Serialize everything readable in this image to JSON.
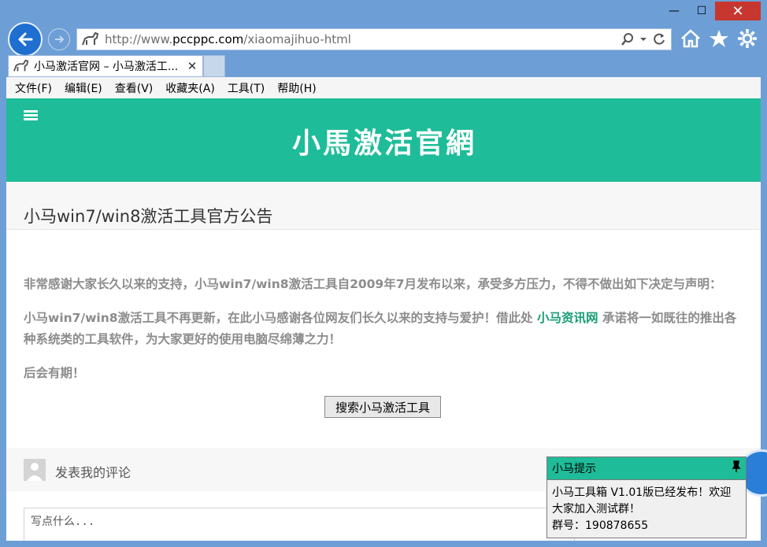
{
  "browser": {
    "url_prefix": "http://www.",
    "url_host": "pccppc.com",
    "url_path": "/xiaomajihuo-html",
    "tab_title": "小马激活官网 – 小马激活工...",
    "window_controls": {
      "minimize": "—",
      "maximize": "☐",
      "close": "✕"
    }
  },
  "menu": {
    "items": [
      "文件(F)",
      "编辑(E)",
      "查看(V)",
      "收藏夹(A)",
      "工具(T)",
      "帮助(H)"
    ]
  },
  "site": {
    "logo_text": "小馬激活官網",
    "notice_title": "小马win7/win8激活工具官方公告",
    "para1": "非常感谢大家长久以来的支持，小马win7/win8激活工具自2009年7月发布以来，承受多方压力，不得不做出如下决定与声明：",
    "para2_before": "小马win7/win8激活工具不再更新，在此小马感谢各位网友们长久以来的支持与爱护！借此处 ",
    "para2_link": "小马资讯网",
    "para2_after": " 承诺将一如既往的推出各种系统类的工具软件，为大家更好的使用电脑尽绵薄之力！",
    "para3": "后会有期！",
    "search_button": "搜索小马激活工具",
    "comment_label": "发表我的评论",
    "comment_placeholder": "写点什么..."
  },
  "popup": {
    "title": "小马提示",
    "line1": "小马工具箱 V1.01版已经发布！欢迎大家加入测试群！",
    "line2": "群号：190878655"
  },
  "colors": {
    "accent": "#1ebc98",
    "link": "#179d74",
    "title_bar": "#6d9fd6"
  }
}
